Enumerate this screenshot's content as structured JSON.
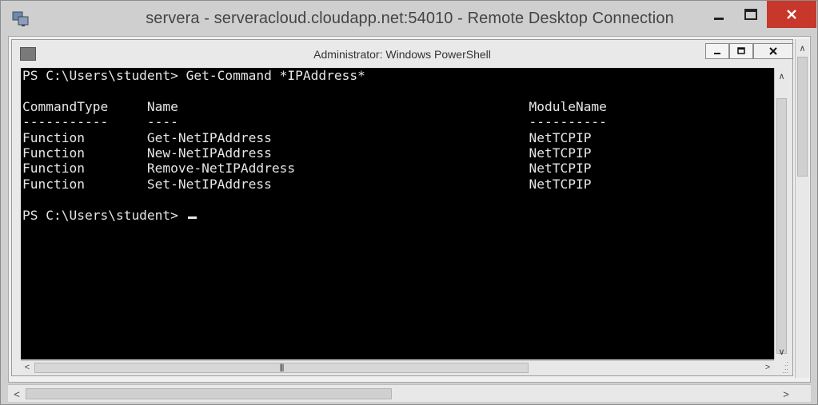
{
  "rdp_window": {
    "title": "servera - serveracloud.cloudapp.net:54010 - Remote Desktop Connection",
    "close_color": "#c7372b"
  },
  "powershell_window": {
    "title": "Administrator: Windows PowerShell"
  },
  "console": {
    "command_line": "PS C:\\Users\\student> Get-Command *IPAddress*",
    "columns": [
      "CommandType",
      "Name",
      "ModuleName"
    ],
    "underlines": [
      "-----------",
      "----",
      "----------"
    ],
    "rows": [
      [
        "Function",
        "Get-NetIPAddress",
        "NetTCPIP"
      ],
      [
        "Function",
        "New-NetIPAddress",
        "NetTCPIP"
      ],
      [
        "Function",
        "Remove-NetIPAddress",
        "NetTCPIP"
      ],
      [
        "Function",
        "Set-NetIPAddress",
        "NetTCPIP"
      ]
    ],
    "prompt": "PS C:\\Users\\student> ",
    "background": "#000000",
    "foreground": "#e6e6e6"
  },
  "icons": {
    "rdp": "remote-desktop-icon",
    "ps": "powershell-icon"
  }
}
